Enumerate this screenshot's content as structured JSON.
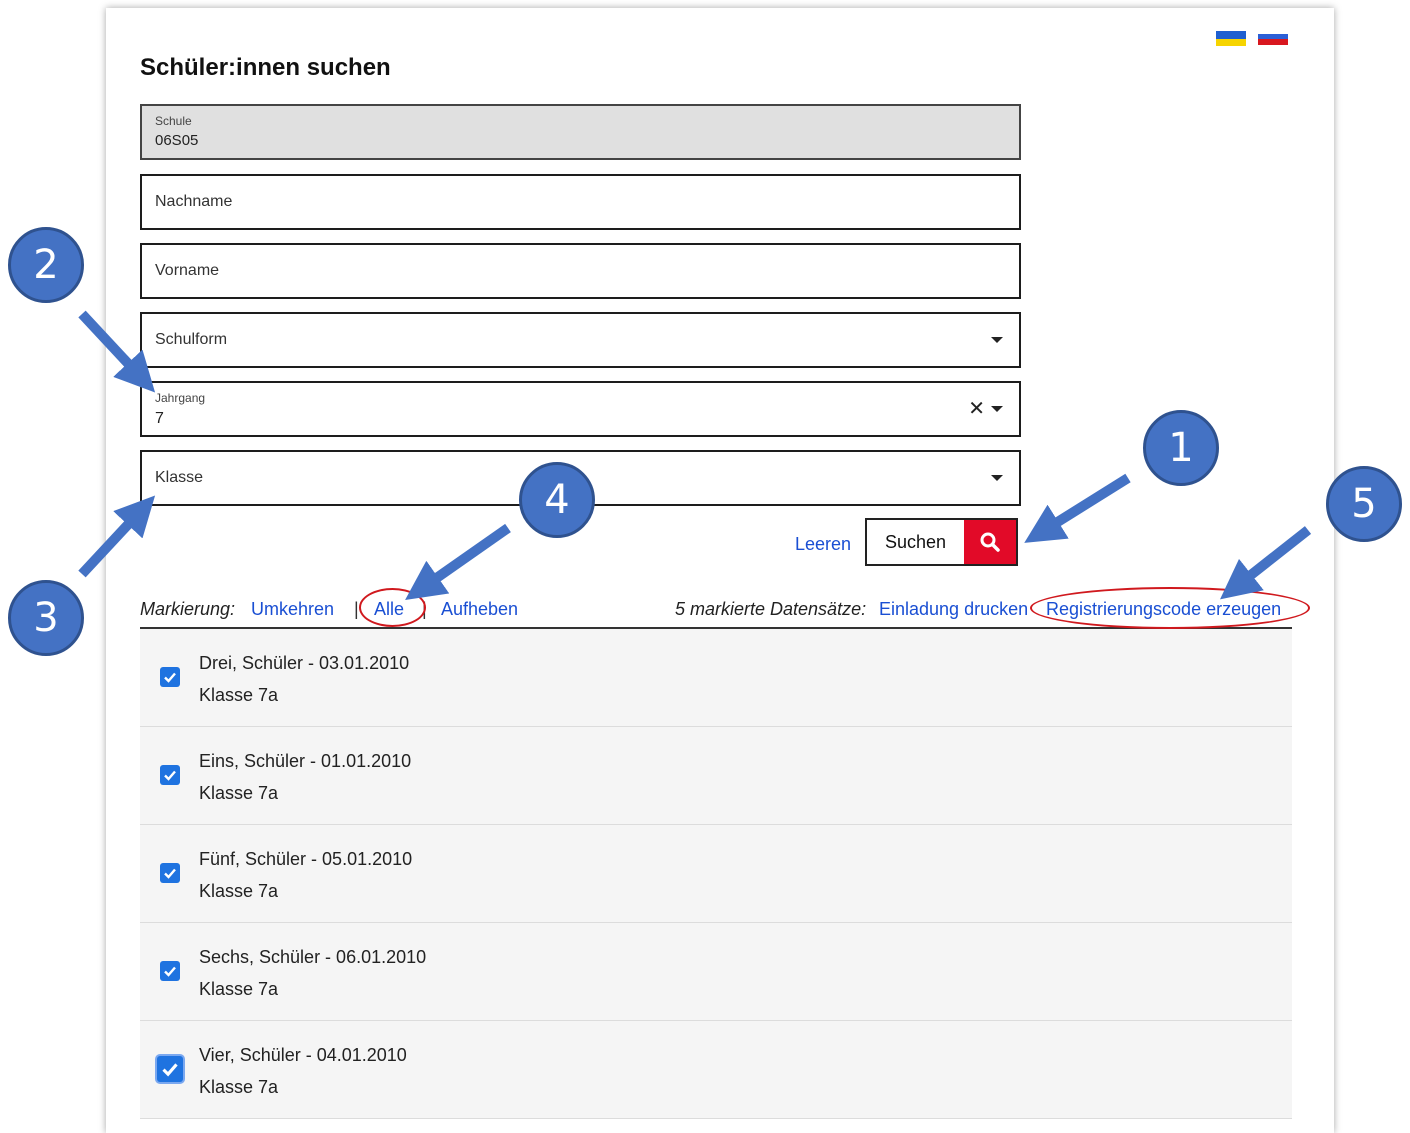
{
  "flags": {
    "ukrainian": "flag-ua-icon",
    "russian": "flag-ru-icon"
  },
  "title": "Schüler:innen suchen",
  "form": {
    "schule": {
      "label": "Schule",
      "value": "06S05"
    },
    "nachname": {
      "placeholder": "Nachname"
    },
    "vorname": {
      "placeholder": "Vorname"
    },
    "schulform": {
      "placeholder": "Schulform"
    },
    "jahrgang": {
      "label": "Jahrgang",
      "value": "7",
      "clear": "✕"
    },
    "klasse": {
      "placeholder": "Klasse"
    }
  },
  "actions": {
    "clear_label": "Leeren",
    "search_label": "Suchen"
  },
  "marking": {
    "label": "Markierung:",
    "invert": "Umkehren",
    "all": "Alle",
    "none": "Aufheben",
    "separator": "|",
    "selected_info": "5 markierte Datensätze:",
    "print_invitation": "Einladung drucken",
    "generate_code": "Registrierungscode erzeugen"
  },
  "students": [
    {
      "name": "Drei, Schüler - 03.01.2010",
      "klasse": "Klasse 7a",
      "checked": true
    },
    {
      "name": "Eins, Schüler - 01.01.2010",
      "klasse": "Klasse 7a",
      "checked": true
    },
    {
      "name": "Fünf, Schüler - 05.01.2010",
      "klasse": "Klasse 7a",
      "checked": true
    },
    {
      "name": "Sechs, Schüler - 06.01.2010",
      "klasse": "Klasse 7a",
      "checked": true
    },
    {
      "name": "Vier, Schüler - 04.01.2010",
      "klasse": "Klasse 7a",
      "checked": true
    }
  ],
  "annotations": {
    "b1": "1",
    "b2": "2",
    "b3": "3",
    "b4": "4",
    "b5": "5"
  },
  "colors": {
    "accent_link": "#1a4fd3",
    "search_red": "#e20a28",
    "badge_blue": "#4472c4",
    "highlight_red": "#d0191e",
    "checkbox": "#1f73e0"
  }
}
